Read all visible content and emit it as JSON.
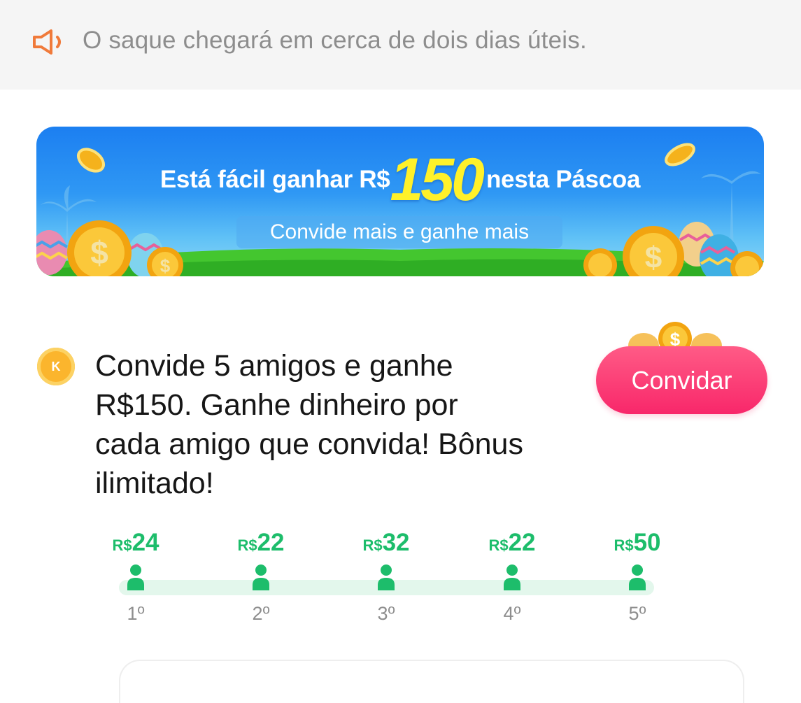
{
  "notice": {
    "icon": "speaker-icon",
    "text": "O saque chegará em cerca de dois dias úteis.",
    "icon_color": "#f07a3a"
  },
  "banner": {
    "headline_before": "Está fácil ganhar R$",
    "headline_amount": "150",
    "headline_after": "nesta Páscoa",
    "subtitle": "Convide mais e ganhe mais",
    "amount_color": "#fff12a"
  },
  "invite": {
    "badge_letter": "K",
    "description": "Convide 5 amigos e ganhe R$150. Ganhe dinheiro por cada amigo que convida! Bônus ilimitado!",
    "button_label": "Convidar",
    "button_color": "#f8276a"
  },
  "rewards": {
    "accent_color": "#1dbd6b",
    "steps": [
      {
        "currency": "R$",
        "value": "24",
        "ordinal": "1º"
      },
      {
        "currency": "R$",
        "value": "22",
        "ordinal": "2º"
      },
      {
        "currency": "R$",
        "value": "32",
        "ordinal": "3º"
      },
      {
        "currency": "R$",
        "value": "22",
        "ordinal": "4º"
      },
      {
        "currency": "R$",
        "value": "50",
        "ordinal": "5º"
      }
    ]
  }
}
